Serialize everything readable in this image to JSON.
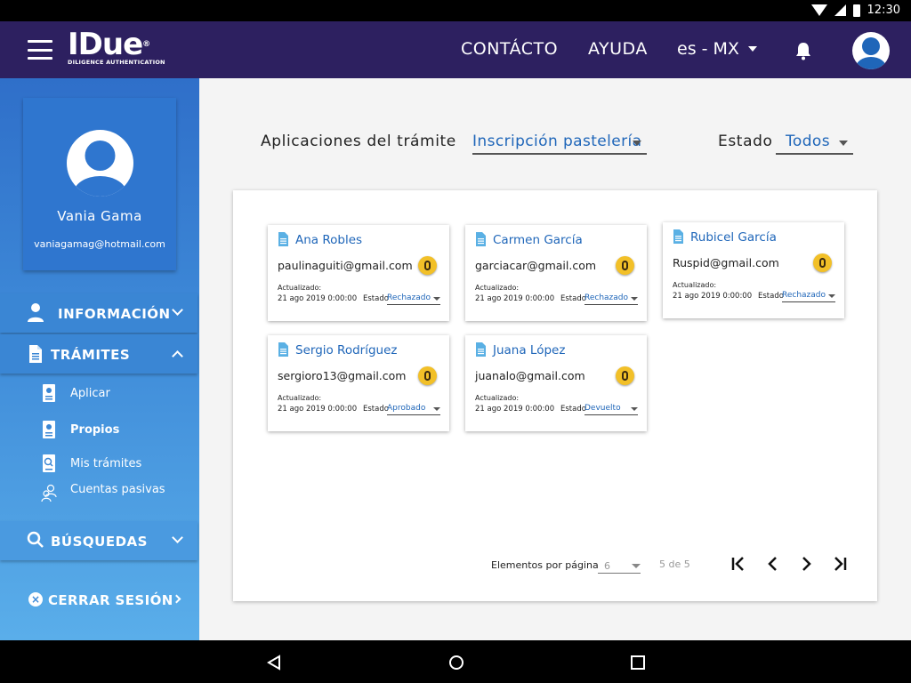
{
  "status_bar": {
    "time": "12:30"
  },
  "app_bar": {
    "brand": "IDue",
    "brand_mark": "®",
    "tagline": "DILIGENCE AUTHENTICATION",
    "nav": {
      "contact": "CONTÁCTO",
      "help": "AYUDA"
    },
    "language": "es - MX"
  },
  "sidebar": {
    "profile": {
      "name": "Vania Gama",
      "email": "vaniagamag@hotmail.com"
    },
    "sections": {
      "info": "INFORMACIÓN",
      "procedures": "TRÁMITES",
      "search": "BÚSQUEDAS"
    },
    "sub_items": {
      "apply": "Aplicar",
      "own": "Propios",
      "my_procedures": "Mis trámites",
      "passive_accounts": "Cuentas pasivas"
    },
    "logout": "CERRAR SESIÓN"
  },
  "filters": {
    "procedure_label": "Aplicaciones del trámite",
    "procedure_value": "Inscripción pastelería",
    "state_label": "Estado",
    "state_value": "Todos"
  },
  "cards": {
    "updated_label": "Actualizado:",
    "state_label": "Estado",
    "items": [
      {
        "name": "Ana Robles",
        "email": "paulinaguiti@gmail.com",
        "date": "21 ago 2019 0:00:00",
        "status": "Rechazado"
      },
      {
        "name": "Carmen García",
        "email": "garciacar@gmail.com",
        "date": "21 ago 2019 0:00:00",
        "status": "Rechazado"
      },
      {
        "name": "Rubicel García",
        "email": "Ruspid@gmail.com",
        "date": "21 ago 2019 0:00:00",
        "status": "Rechazado"
      },
      {
        "name": "Sergio Rodríguez",
        "email": "sergioro13@gmail.com",
        "date": "21 ago 2019 0:00:00",
        "status": "Aprobado"
      },
      {
        "name": "Juana López",
        "email": "juanalo@gmail.com",
        "date": "21 ago 2019 0:00:00",
        "status": "Devuelto"
      }
    ]
  },
  "pagination": {
    "per_page_label": "Elementos por página",
    "per_page_value": "6",
    "count": "5 de 5"
  }
}
